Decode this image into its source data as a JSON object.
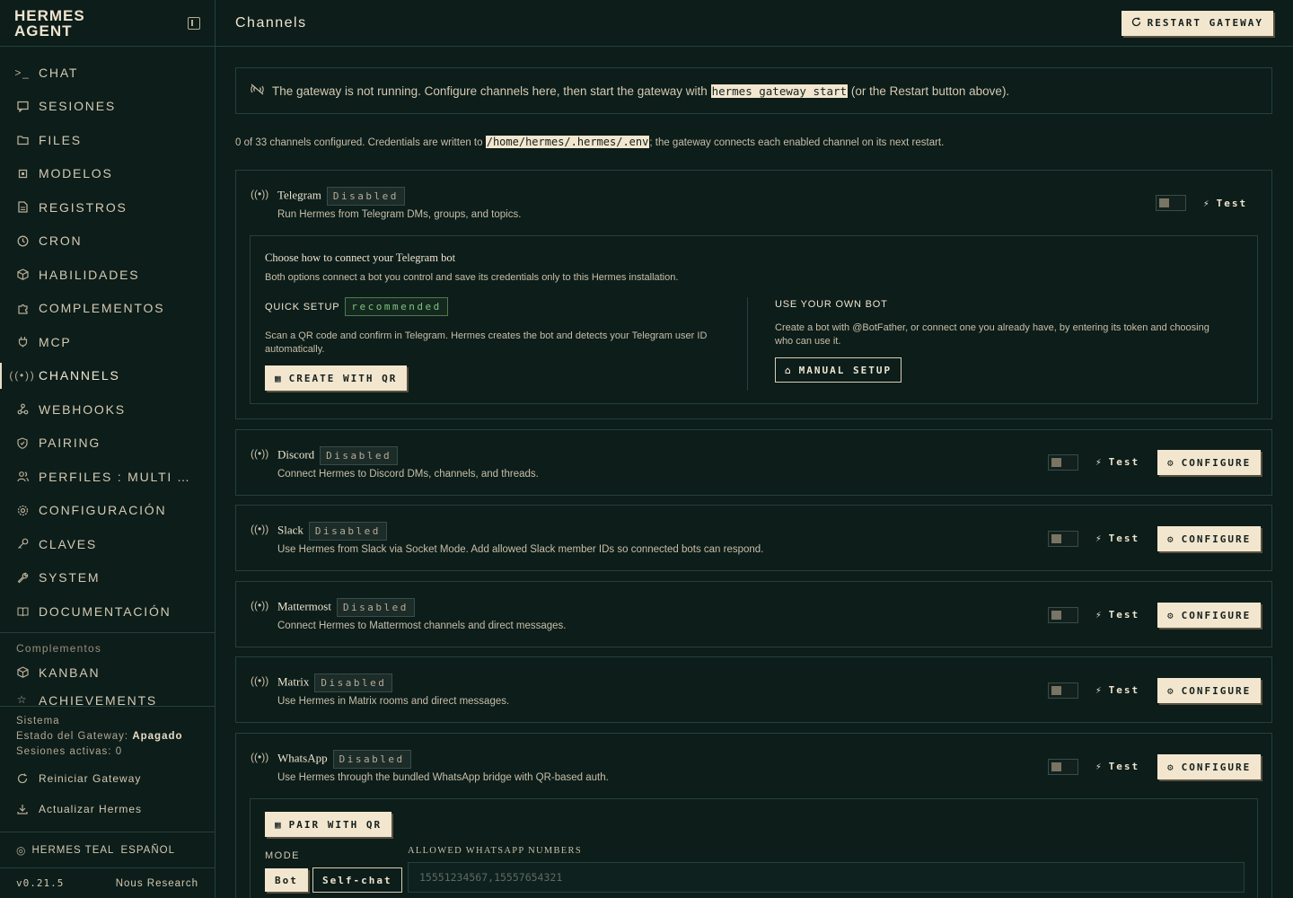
{
  "brand": {
    "line1": "HERMES",
    "line2": "AGENT"
  },
  "nav": [
    {
      "label": "CHAT",
      "icon": "terminal-icon"
    },
    {
      "label": "SESIONES",
      "icon": "message-icon"
    },
    {
      "label": "FILES",
      "icon": "folder-icon"
    },
    {
      "label": "MODELOS",
      "icon": "cpu-icon"
    },
    {
      "label": "REGISTROS",
      "icon": "document-icon"
    },
    {
      "label": "CRON",
      "icon": "clock-icon"
    },
    {
      "label": "HABILIDADES",
      "icon": "package-icon"
    },
    {
      "label": "COMPLEMENTOS",
      "icon": "puzzle-icon"
    },
    {
      "label": "MCP",
      "icon": "plug-icon"
    },
    {
      "label": "CHANNELS",
      "icon": "broadcast-icon"
    },
    {
      "label": "WEBHOOKS",
      "icon": "webhook-icon"
    },
    {
      "label": "PAIRING",
      "icon": "shield-icon"
    },
    {
      "label": "PERFILES : MULTI AGENTES",
      "icon": "users-icon"
    },
    {
      "label": "CONFIGURACIÓN",
      "icon": "gear-icon"
    },
    {
      "label": "CLAVES",
      "icon": "key-icon"
    },
    {
      "label": "SYSTEM",
      "icon": "wrench-icon"
    },
    {
      "label": "DOCUMENTACIÓN",
      "icon": "book-icon"
    }
  ],
  "plugins_section": {
    "label": "Complementos",
    "items": [
      {
        "label": "KANBAN"
      },
      {
        "label": "ACHIEVEMENTS"
      }
    ]
  },
  "system": {
    "label": "Sistema",
    "gateway_label": "Estado del Gateway:",
    "gateway_value": "Apagado",
    "sessions_label": "Sesiones activas:",
    "sessions_value": "0",
    "restart": "Reiniciar Gateway",
    "update": "Actualizar Hermes"
  },
  "footer": {
    "theme": "HERMES TEAL",
    "language": "ESPAÑOL",
    "version": "v0.21.5",
    "vendor": "Nous Research"
  },
  "header": {
    "title": "Channels",
    "restart_button": "RESTART GATEWAY"
  },
  "alert": {
    "text_before": "The gateway is not running. Configure channels here, then start the gateway with",
    "command": "hermes gateway start",
    "text_after": "(or the Restart button above)."
  },
  "info": {
    "text_before": "0 of 33 channels configured. Credentials are written to",
    "path": "/home/hermes/.hermes/.env",
    "text_after": "; the gateway connects each enabled channel on its next restart."
  },
  "labels": {
    "disabled": "Disabled",
    "test": "Test",
    "configure": "CONFIGURE"
  },
  "telegram": {
    "name": "Telegram",
    "desc": "Run Hermes from Telegram DMs, groups, and topics.",
    "sub_title": "Choose how to connect your Telegram bot",
    "sub_desc": "Both options connect a bot you control and save its credentials only to this Hermes installation.",
    "quick_label": "QUICK SETUP",
    "quick_badge": "recommended",
    "quick_text": "Scan a QR code and confirm in Telegram. Hermes creates the bot and detects your Telegram user ID automatically.",
    "quick_button": "CREATE WITH QR",
    "own_label": "USE YOUR OWN BOT",
    "own_text": "Create a bot with @BotFather, or connect one you already have, by entering its token and choosing who can use it.",
    "own_button": "MANUAL SETUP"
  },
  "channels": [
    {
      "name": "Discord",
      "desc": "Connect Hermes to Discord DMs, channels, and threads."
    },
    {
      "name": "Slack",
      "desc": "Use Hermes from Slack via Socket Mode. Add allowed Slack member IDs so connected bots can respond."
    },
    {
      "name": "Mattermost",
      "desc": "Connect Hermes to Mattermost channels and direct messages."
    },
    {
      "name": "Matrix",
      "desc": "Use Hermes in Matrix rooms and direct messages."
    }
  ],
  "whatsapp": {
    "name": "WhatsApp",
    "desc": "Use Hermes through the bundled WhatsApp bridge with QR-based auth.",
    "pair_button": "PAIR WITH QR",
    "mode_label": "MODE",
    "mode_bot": "Bot",
    "mode_self": "Self-chat",
    "numbers_label": "ALLOWED WHATSAPP NUMBERS",
    "numbers_placeholder": "15551234567,15557654321"
  },
  "colors": {
    "background": "#0c1d1a",
    "border": "#25413b",
    "accent_light": "#f3e6cf",
    "text": "#e8dcc6",
    "badge_green": "#7fc37f"
  }
}
